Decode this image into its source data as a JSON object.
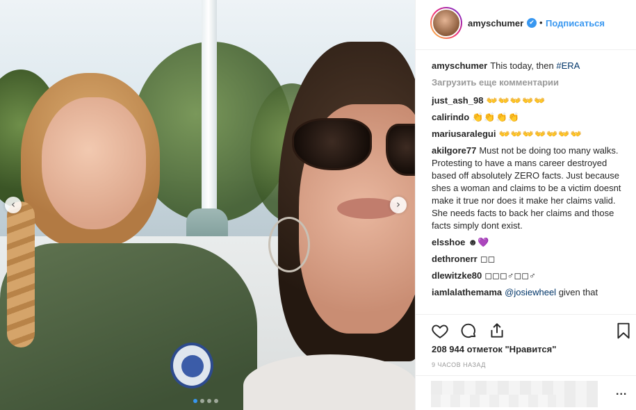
{
  "post": {
    "photo_alt": "",
    "carousel": {
      "total": 4,
      "active_index": 0
    }
  },
  "header": {
    "username": "amyschumer",
    "verified_icon": "✔",
    "separator": "•",
    "follow_label": "Подписаться"
  },
  "caption": {
    "username": "amyschumer",
    "text": "This today, then ",
    "hashtag": "#ERA"
  },
  "load_more_label": "Загрузить еще комментарии",
  "comments": [
    {
      "username": "just_ash_98",
      "text": "👐👐👐👐👐"
    },
    {
      "username": "calirindo",
      "text": "👏👏👏👏"
    },
    {
      "username": "mariusaralegui",
      "text": "👐👐👐👐👐👐👐"
    },
    {
      "username": "akilgore77",
      "text": "Must not be doing too many walks. Protesting to have a mans career destroyed based off absolutely ZERO facts. Just because shes a woman and claims to be a victim doesnt make it true nor does it make her claims valid. She needs facts to back her claims and those facts simply dont exist."
    },
    {
      "username": "elsshoe",
      "text": "☻",
      "heart": "💜"
    },
    {
      "username": "dethronerr",
      "text": "◻◻"
    },
    {
      "username": "dlewitzke80",
      "text": "◻◻◻♂◻◻♂"
    },
    {
      "username": "iamlalathemama",
      "mention": "@josiewheel",
      "text": " given that"
    }
  ],
  "likes_label": "208 944 отметок \"Нравится\"",
  "time_label": "9 часов назад",
  "more_label": "...",
  "icons": {
    "like": "heart-icon",
    "comment": "comment-icon",
    "share": "share-icon",
    "save": "bookmark-icon",
    "prev": "chevron-left-icon",
    "next": "chevron-right-icon"
  },
  "colors": {
    "accent": "#3897f0",
    "hashtag": "#003569",
    "muted": "#999999"
  }
}
